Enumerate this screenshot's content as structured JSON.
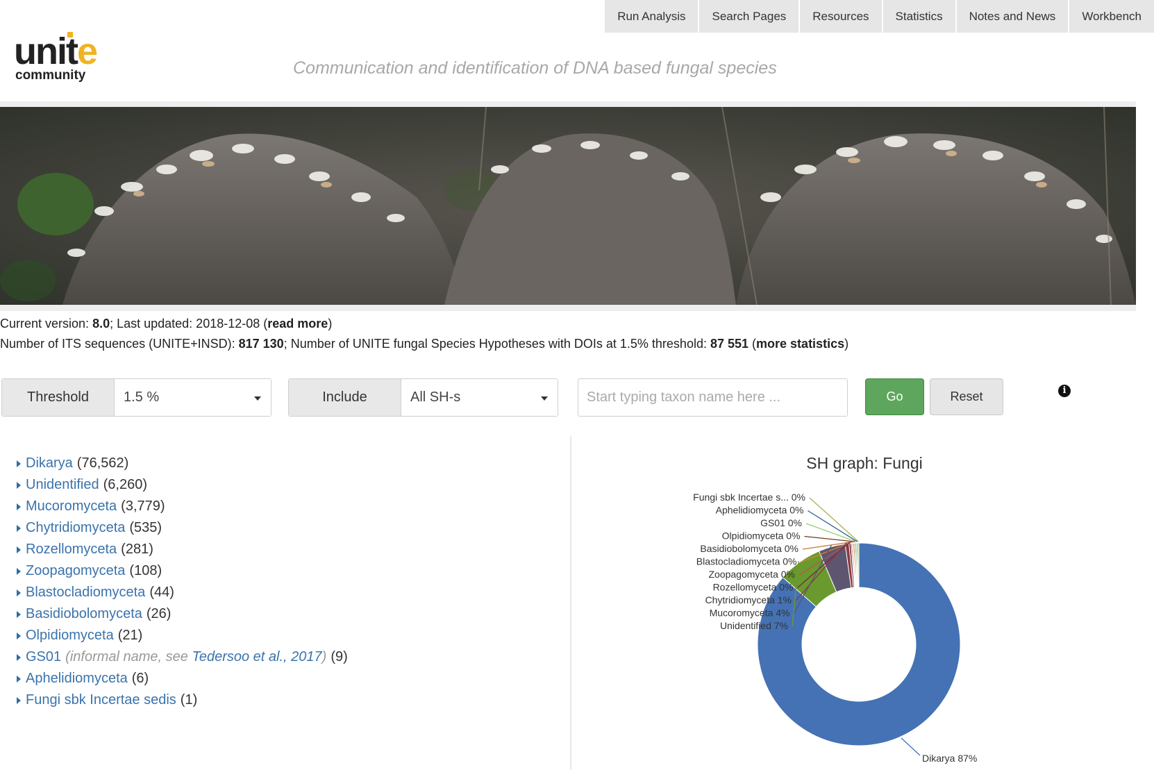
{
  "nav": [
    "Run Analysis",
    "Search Pages",
    "Resources",
    "Statistics",
    "Notes and News",
    "Workbench"
  ],
  "logo": {
    "main_a": "unit",
    "main_b": "e",
    "sub": "community"
  },
  "tagline": "Communication and identification of DNA based fungal species",
  "banner": {
    "image": "mushroom-photo"
  },
  "info": {
    "version_label": "Current version: ",
    "version": "8.0",
    "updated_label": "; Last updated: 2018-12-08 (",
    "read_more": "read more",
    "close_paren": ")",
    "seq_label": "Number of ITS sequences (UNITE+INSD): ",
    "seq_count": "817 130",
    "sh_label": "; Number of UNITE fungal Species Hypotheses with DOIs at 1.5% threshold: ",
    "sh_count": "87 551",
    "open_paren": " (",
    "more_stats": "more statistics",
    "close_paren2": ")"
  },
  "filters": {
    "threshold_label": "Threshold",
    "threshold_value": "1.5 %",
    "include_label": "Include",
    "include_value": "All SH-s",
    "search_placeholder": "Start typing taxon name here ...",
    "go_label": "Go",
    "reset_label": "Reset",
    "info_icon": "i"
  },
  "taxa": [
    {
      "name": "Dikarya",
      "count": "(76,562)"
    },
    {
      "name": "Unidentified",
      "count": "(6,260)"
    },
    {
      "name": "Mucoromyceta",
      "count": "(3,779)"
    },
    {
      "name": "Chytridiomyceta",
      "count": "(535)"
    },
    {
      "name": "Rozellomyceta",
      "count": "(281)"
    },
    {
      "name": "Zoopagomyceta",
      "count": "(108)"
    },
    {
      "name": "Blastocladiomyceta",
      "count": "(44)"
    },
    {
      "name": "Basidiobolomyceta",
      "count": "(26)"
    },
    {
      "name": "Olpidiomyceta",
      "count": "(21)"
    },
    {
      "name": "GS01",
      "note_pre": "(informal name, see ",
      "note_link": "Tedersoo et al., 2017",
      "note_post": ")",
      "count": "(9)"
    },
    {
      "name": "Aphelidiomyceta",
      "count": "(6)"
    },
    {
      "name": "Fungi sbk Incertae sedis",
      "count": "(1)"
    }
  ],
  "chart_data": {
    "type": "pie",
    "title": "SH graph: Fungi",
    "slices": [
      {
        "label": "Dikarya",
        "value": 76562,
        "pct": "87%",
        "color": "#4472b4"
      },
      {
        "label": "Unidentified",
        "value": 6260,
        "pct": "7%",
        "color": "#6a9a2e"
      },
      {
        "label": "Mucoromyceta",
        "value": 3779,
        "pct": "4%",
        "color": "#5e5571"
      },
      {
        "label": "Chytridiomyceta",
        "value": 535,
        "pct": "1%",
        "color": "#8b3a3a"
      },
      {
        "label": "Rozellomyceta",
        "value": 281,
        "pct": "0%",
        "color": "#6b2c4a"
      },
      {
        "label": "Zoopagomyceta",
        "value": 108,
        "pct": "0%",
        "color": "#c0504d"
      },
      {
        "label": "Blastocladiomyceta",
        "value": 44,
        "pct": "0%",
        "color": "#d9822b"
      },
      {
        "label": "Basidiobolomyceta",
        "value": 26,
        "pct": "0%",
        "color": "#c47a3c"
      },
      {
        "label": "Olpidiomyceta",
        "value": 21,
        "pct": "0%",
        "color": "#7a3a1e"
      },
      {
        "label": "GS01",
        "value": 9,
        "pct": "0%",
        "color": "#8fd16a"
      },
      {
        "label": "Aphelidiomyceta",
        "value": 6,
        "pct": "0%",
        "color": "#2f5f8f"
      },
      {
        "label": "Fungi sbk Incertae s...",
        "value": 1,
        "pct": "0%",
        "color": "#a7b05a"
      }
    ]
  }
}
